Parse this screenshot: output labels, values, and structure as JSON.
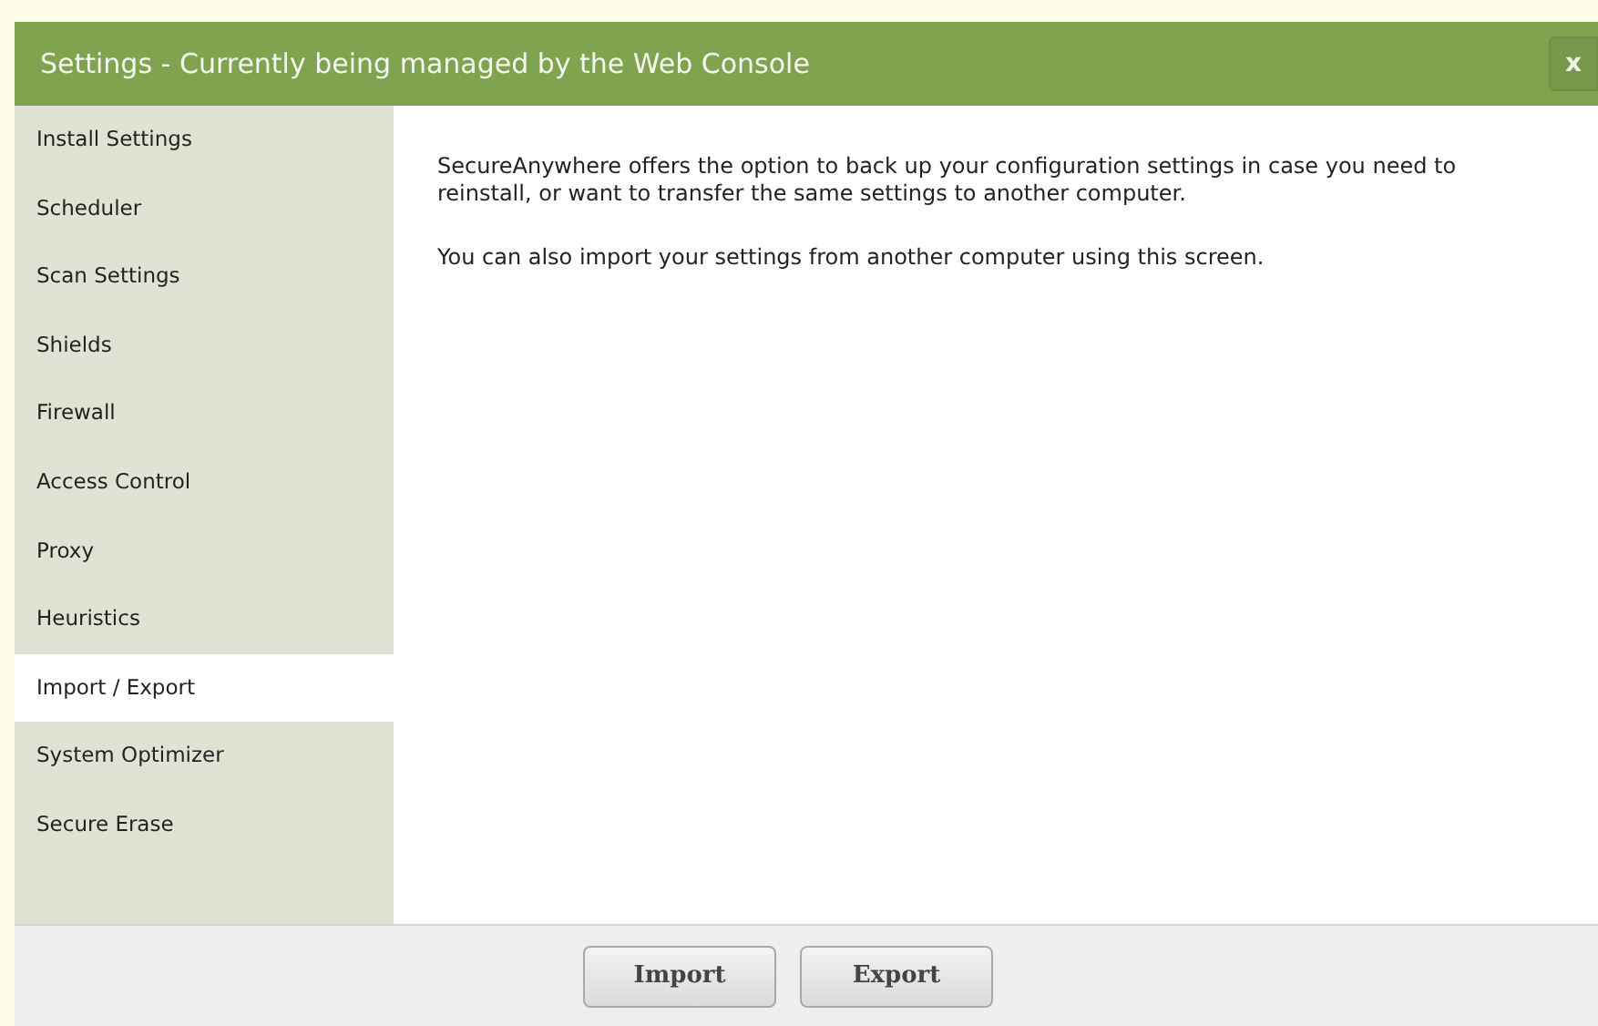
{
  "window": {
    "title": "Settings - Currently being managed by the Web Console",
    "close": "x"
  },
  "sidebar": {
    "items": [
      {
        "label": "Install Settings",
        "selected": false
      },
      {
        "label": "Scheduler",
        "selected": false
      },
      {
        "label": "Scan Settings",
        "selected": false
      },
      {
        "label": "Shields",
        "selected": false
      },
      {
        "label": "Firewall",
        "selected": false
      },
      {
        "label": "Access Control",
        "selected": false
      },
      {
        "label": "Proxy",
        "selected": false
      },
      {
        "label": "Heuristics",
        "selected": false
      },
      {
        "label": "Import / Export",
        "selected": true
      },
      {
        "label": "System Optimizer",
        "selected": false
      },
      {
        "label": "Secure Erase",
        "selected": false
      }
    ]
  },
  "content": {
    "paragraphs": [
      "SecureAnywhere offers the option to back up your configuration settings in case you need to reinstall, or want to transfer the same settings to another computer.",
      "You can also import your settings from another computer using this screen."
    ]
  },
  "buttons": [
    "Import",
    "Export"
  ]
}
